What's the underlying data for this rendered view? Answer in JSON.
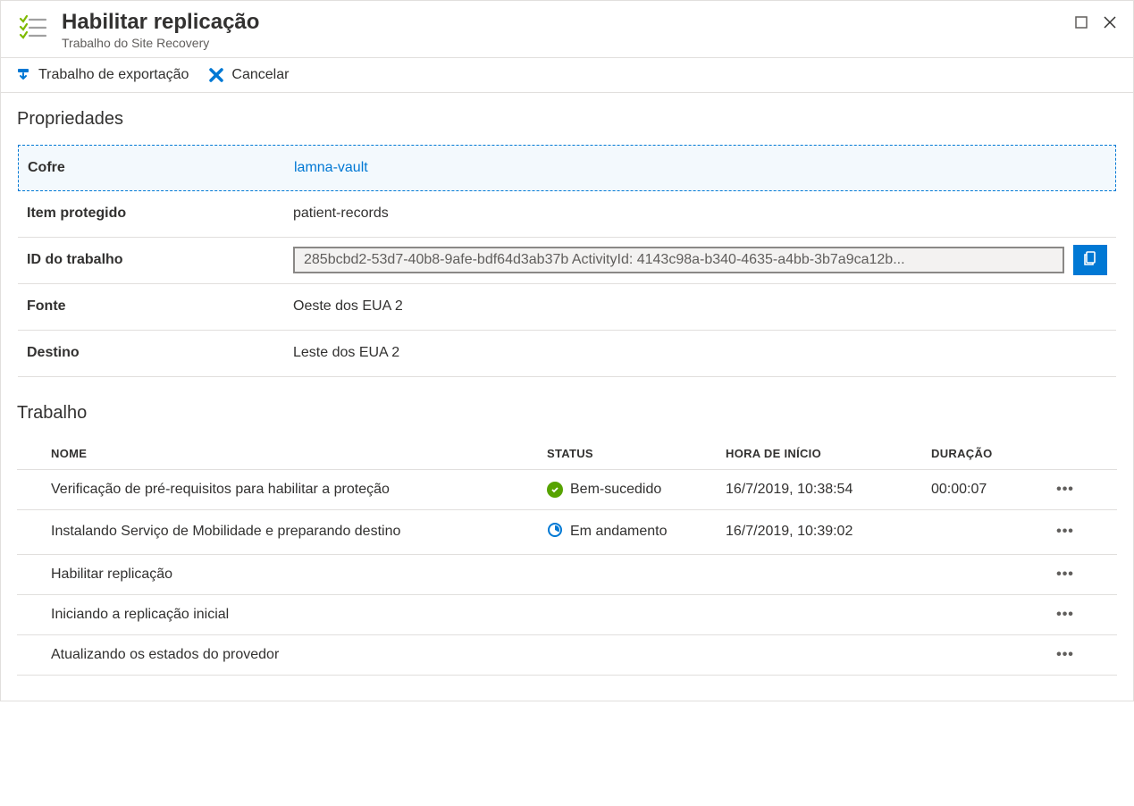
{
  "header": {
    "title": "Habilitar replicação",
    "subtitle": "Trabalho do Site Recovery"
  },
  "toolbar": {
    "export": "Trabalho de exportação",
    "cancel": "Cancelar"
  },
  "sections": {
    "properties": "Propriedades",
    "job": "Trabalho"
  },
  "properties": {
    "vault_label": "Cofre",
    "vault_value": "lamna-vault",
    "protected_label": "Item protegido",
    "protected_value": "patient-records",
    "jobid_label": "ID do trabalho",
    "jobid_value": "285bcbd2-53d7-40b8-9afe-bdf64d3ab37b ActivityId: 4143c98a-b340-4635-a4bb-3b7a9ca12b...",
    "source_label": "Fonte",
    "source_value": "Oeste dos EUA 2",
    "target_label": "Destino",
    "target_value": "Leste dos EUA 2"
  },
  "job_table": {
    "headers": {
      "name": "NOME",
      "status": "STATUS",
      "start": "HORA DE INÍCIO",
      "duration": "DURAÇÃO"
    },
    "rows": [
      {
        "name": "Verificação de pré-requisitos para habilitar a proteção",
        "status": "Bem-sucedido",
        "status_type": "success",
        "start": "16/7/2019, 10:38:54",
        "duration": "00:00:07"
      },
      {
        "name": "Instalando Serviço de Mobilidade e preparando destino",
        "status": "Em andamento",
        "status_type": "progress",
        "start": "16/7/2019, 10:39:02",
        "duration": ""
      },
      {
        "name": "Habilitar replicação",
        "status": "",
        "status_type": "",
        "start": "",
        "duration": ""
      },
      {
        "name": "Iniciando a replicação inicial",
        "status": "",
        "status_type": "",
        "start": "",
        "duration": ""
      },
      {
        "name": "Atualizando os estados do provedor",
        "status": "",
        "status_type": "",
        "start": "",
        "duration": ""
      }
    ]
  }
}
